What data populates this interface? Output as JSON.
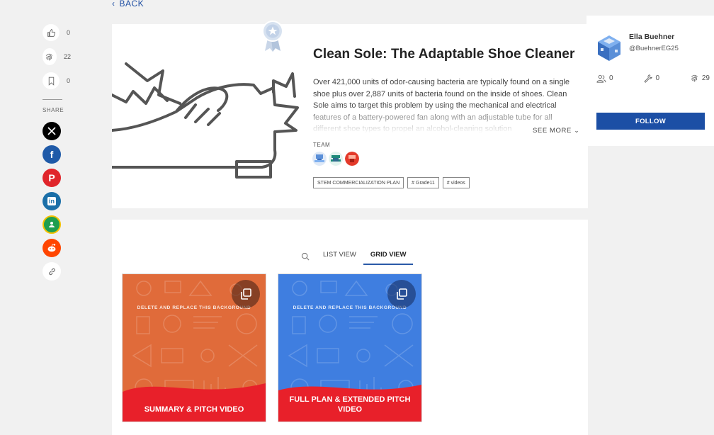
{
  "nav": {
    "back_label": "BACK"
  },
  "side_rail": {
    "likes": "0",
    "views": "22",
    "saves": "0",
    "share_label": "SHARE",
    "share_buttons": [
      {
        "name": "x",
        "color": "#000000",
        "glyph": "𝕏"
      },
      {
        "name": "facebook",
        "color": "#1f5aa8",
        "glyph": "f"
      },
      {
        "name": "pinterest",
        "color": "#e0252b",
        "glyph": "P"
      },
      {
        "name": "linkedin",
        "color": "#1b6fa8",
        "glyph": "in"
      },
      {
        "name": "google-classroom",
        "color": "#1e9e4f",
        "glyph": "●"
      },
      {
        "name": "reddit",
        "color": "#ff4500",
        "glyph": "●"
      },
      {
        "name": "copy-link",
        "color": "#ffffff",
        "glyph": "🔗"
      }
    ]
  },
  "project": {
    "title": "Clean Sole: The Adaptable Shoe Cleaner",
    "description": "Over 421,000 units of odor-causing bacteria are typically found on a single shoe plus over 2,887 units of bacteria found on the inside of shoes. Clean Sole aims to target this problem by using the mechanical and electrical features of a battery-powered fan along with an adjustable tube for all different shoe types to propel an alcohol-cleaning solution",
    "see_more_label": "SEE MORE",
    "team_label": "TEAM",
    "tags": [
      "STEM COMMERCIALIZATION PLAN",
      "# Grade11",
      "# videos"
    ]
  },
  "user": {
    "name": "Ella Buehner",
    "handle": "@BuehnerEG25",
    "followers": "0",
    "projects": "0",
    "views": "29",
    "follow_label": "FOLLOW"
  },
  "views": {
    "list_label": "LIST VIEW",
    "grid_label": "GRID VIEW"
  },
  "tiles": [
    {
      "caption": "SUMMARY & PITCH VIDEO",
      "bg_text": "DELETE AND REPLACE THIS BACKGROUND",
      "color": "#e06b3a"
    },
    {
      "caption": "FULL PLAN & EXTENDED PITCH VIDEO",
      "bg_text": "DELETE AND REPLACE THIS BACKGROUND",
      "color": "#3f7ee0"
    }
  ],
  "colors": {
    "accent": "#1c4fa5",
    "wave_red": "#e8202a"
  }
}
